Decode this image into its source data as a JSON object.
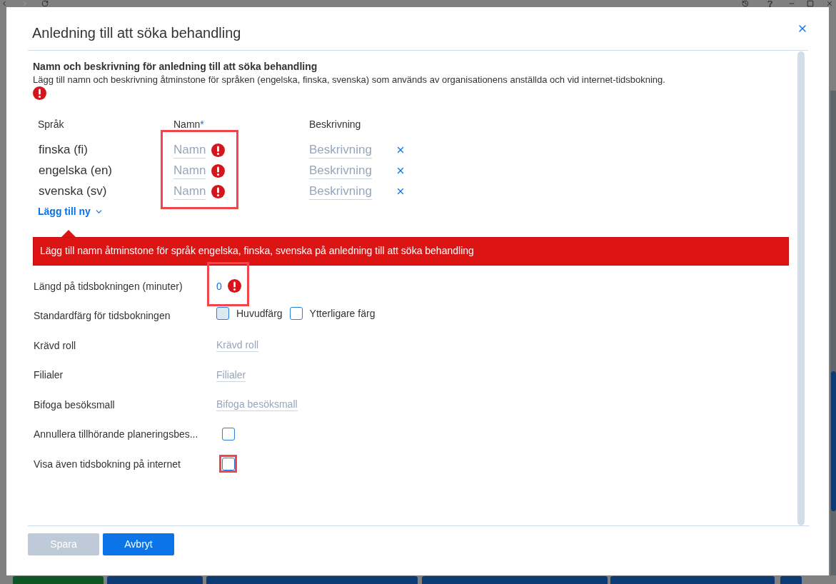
{
  "background": {
    "tabs": [
      {
        "color": "#0e5624"
      },
      {
        "color": "#0b3a74"
      },
      {
        "color": "#0b3a74"
      },
      {
        "color": "#0b3a74"
      },
      {
        "color": "#0b3a74"
      },
      {
        "color": "#0b3a74"
      }
    ]
  },
  "dialog": {
    "title": "Anledning till att söka behandling",
    "section": {
      "heading": "Namn och beskrivning för anledning till att söka behandling",
      "description": "Lägg till namn och beskrivning åtminstone för språken (engelska, finska, svenska) som används av organisationens anställda och vid internet-tidsbokning.",
      "error": true
    },
    "languages": {
      "columns": [
        {
          "label": "Språk"
        },
        {
          "label": "Namn",
          "required_mark": "*"
        },
        {
          "label": "Beskrivning"
        }
      ],
      "name_column_highlighted": true,
      "rows": [
        {
          "language": "finska (fi)",
          "name_placeholder": "Namn",
          "name_error": true,
          "description_placeholder": "Beskrivning"
        },
        {
          "language": "engelska (en)",
          "name_placeholder": "Namn",
          "name_error": true,
          "description_placeholder": "Beskrivning"
        },
        {
          "language": "svenska (sv)",
          "name_placeholder": "Namn",
          "name_error": true,
          "description_placeholder": "Beskrivning"
        }
      ],
      "add_button": "Lägg till ny"
    },
    "error_message": "Lägg till namn åtminstone för språk engelska, finska, svenska på anledning till att söka behandling",
    "fields": [
      {
        "kind": "number",
        "label": "Längd på tidsbokningen (minuter)",
        "value": "0",
        "error": true,
        "highlighted": true
      },
      {
        "kind": "swatches",
        "label": "Standardfärg för tidsbokningen",
        "options": [
          {
            "label": "Huvudfärg",
            "color": "#dbe9f4"
          },
          {
            "label": "Ytterligare färg",
            "color": "#ffffff"
          }
        ],
        "highlighted": false
      },
      {
        "kind": "picker",
        "label": "Krävd roll",
        "placeholder": "Krävd roll",
        "highlighted": false
      },
      {
        "kind": "picker",
        "label": "Filialer",
        "placeholder": "Filialer",
        "highlighted": false
      },
      {
        "kind": "picker",
        "label": "Bifoga besöksmall",
        "placeholder": "Bifoga besöksmall",
        "highlighted": false
      },
      {
        "kind": "checkbox",
        "label": "Annullera tillhörande planeringsbes...",
        "checked": false,
        "highlighted": false
      },
      {
        "kind": "checkbox",
        "label": "Visa även tidsbokning på internet",
        "checked": false,
        "highlighted": true
      }
    ],
    "buttons": [
      {
        "label": "Spara",
        "disabled": true
      },
      {
        "label": "Avbryt",
        "disabled": false
      }
    ]
  }
}
